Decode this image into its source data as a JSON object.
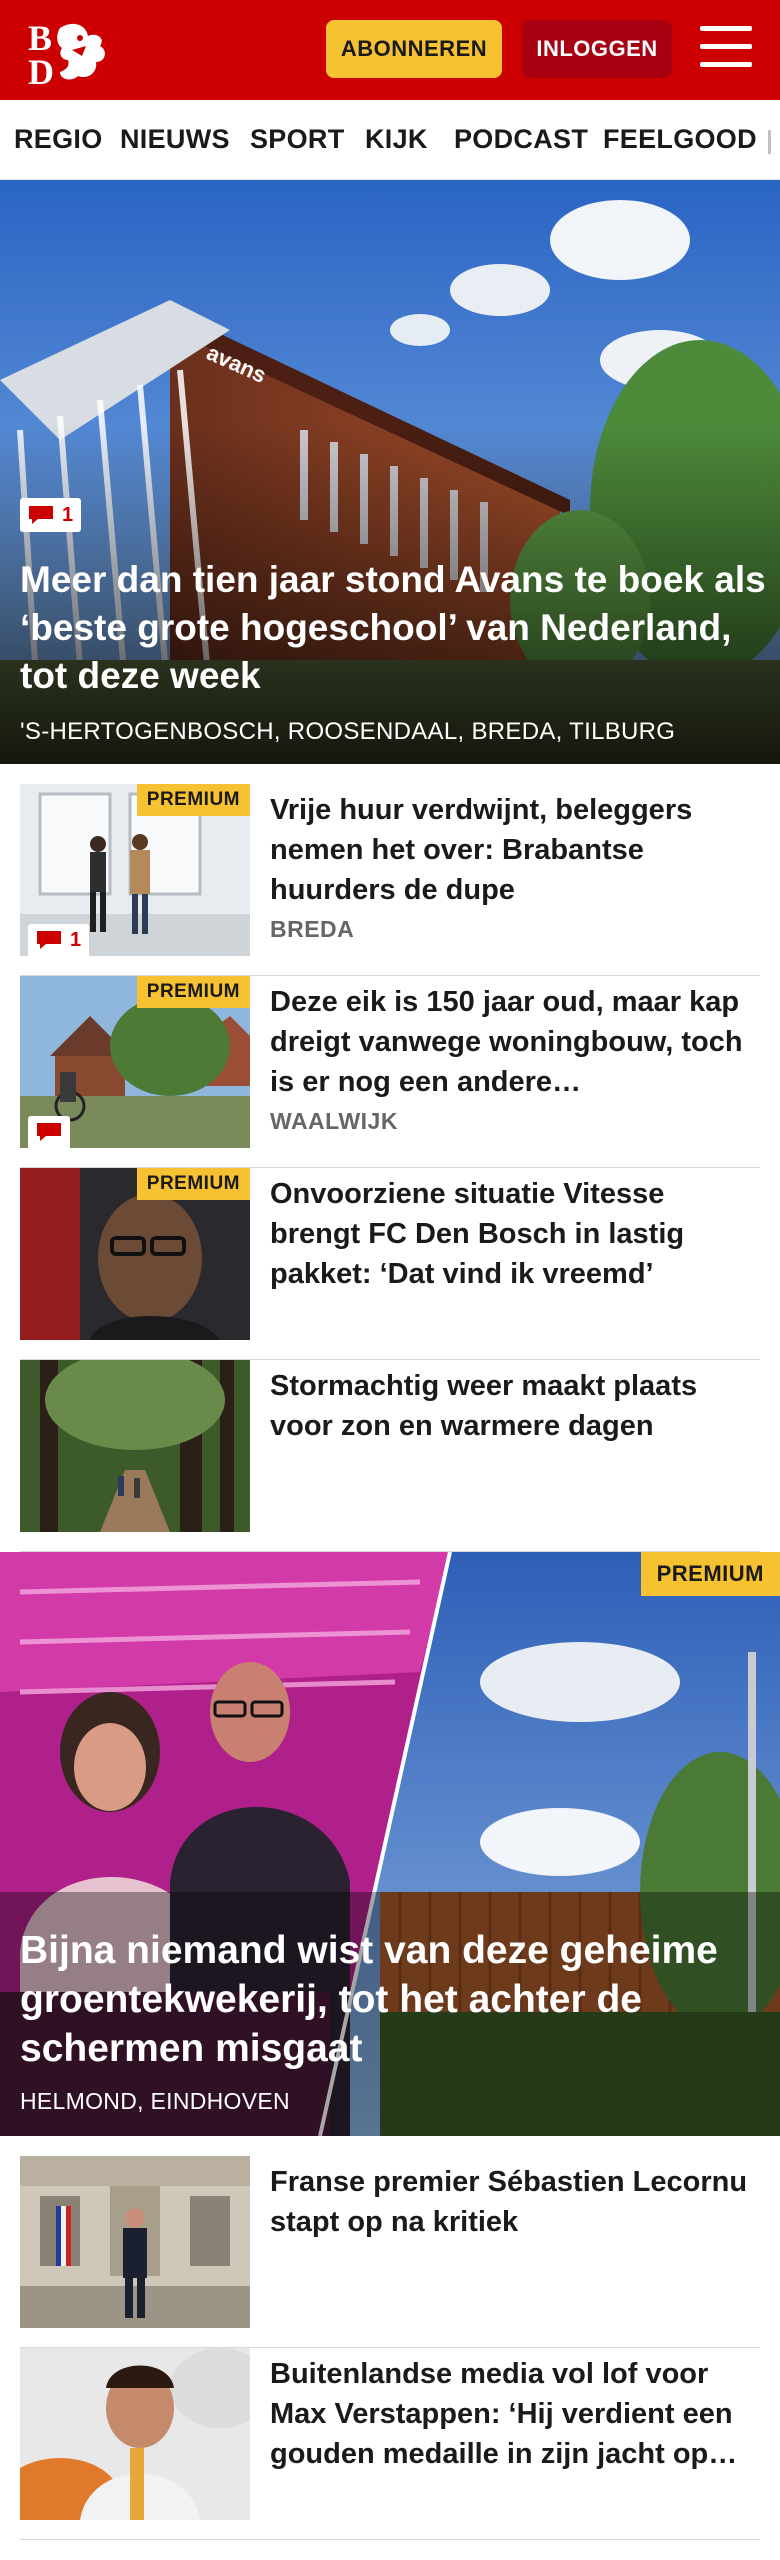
{
  "header": {
    "logo_text": "BD",
    "subscribe_label": "ABONNEREN",
    "login_label": "INLOGGEN",
    "menu_icon": "hamburger-icon",
    "brand_color": "#cc0000",
    "accent_color": "#f7c231"
  },
  "nav": {
    "items": [
      {
        "label": "REGIO"
      },
      {
        "label": "NIEUWS"
      },
      {
        "label": "SPORT"
      },
      {
        "label": "KIJK"
      },
      {
        "label": "PODCAST"
      },
      {
        "label": "FEELGOOD"
      }
    ]
  },
  "hero": {
    "comment_count": "1",
    "building_sign": "avans",
    "title": "Meer dan tien jaar stond Avans te boek als ‘beste grote hogeschool’ van Nederland, tot deze week",
    "tag": "'S-HERTOGENBOSCH, ROOSENDAAL, BREDA, TILBURG"
  },
  "articles": [
    {
      "title": "Vrije huur verdwijnt, beleggers nemen het over: Brabantse huurders de dupe",
      "tag": "BREDA",
      "premium": "PREMIUM",
      "comment_count": "1"
    },
    {
      "title": "Deze eik is 150 jaar oud, maar kap dreigt vanwege woningbouw, toch is er nog een andere…",
      "tag": "WAALWIJK",
      "premium": "PREMIUM",
      "comment_count": ""
    },
    {
      "title": "Onvoorziene situatie Vitesse brengt FC Den Bosch in lastig pakket: ‘Dat vind ik vreemd’",
      "tag": "",
      "premium": "PREMIUM"
    },
    {
      "title": "Stormachtig weer maakt plaats voor zon en warmere dagen",
      "tag": ""
    }
  ],
  "feature": {
    "premium": "PREMIUM",
    "title": "Bijna niemand wist van deze geheime groentekwekerij, tot het achter de schermen misgaat",
    "tag": "HELMOND, EINDHOVEN"
  },
  "articles2": [
    {
      "title": "Franse premier Sébastien Lecornu stapt op na kritiek"
    },
    {
      "title": "Buitenlandse media vol lof voor Max Verstappen: ‘Hij verdient een gouden medaille in zijn jacht op…"
    }
  ]
}
